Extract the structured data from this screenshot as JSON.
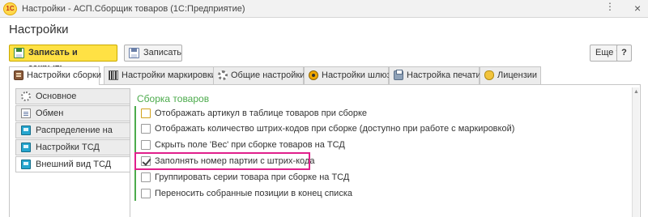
{
  "window": {
    "logo_text": "1С",
    "title": "Настройки - АСП.Сборщик товаров  (1С:Предприятие)",
    "more_glyph": "⋮",
    "close_glyph": "×"
  },
  "page": {
    "title": "Настройки"
  },
  "toolbar": {
    "save_close_label": "Записать и закрыть",
    "save_label": "Записать",
    "more_label": "Еще ▾",
    "help_label": "?"
  },
  "tabs": [
    {
      "label": "Настройки сборки",
      "icon": "settings-icon",
      "active": true
    },
    {
      "label": "Настройки маркировки",
      "icon": "barcode-icon",
      "active": false
    },
    {
      "label": "Общие настройки",
      "icon": "gear-icon",
      "active": false
    },
    {
      "label": "Настройки шлюз",
      "icon": "gateway-icon",
      "active": false
    },
    {
      "label": "Настройка печати",
      "icon": "printer-icon",
      "active": false
    },
    {
      "label": "Лицензии",
      "icon": "license-icon",
      "active": false
    }
  ],
  "sidebar": {
    "items": [
      {
        "label": "Основное",
        "icon": "cog-icon",
        "active": false
      },
      {
        "label": "Обмен",
        "icon": "document-icon",
        "active": false
      },
      {
        "label": "Распределение на ТСД",
        "icon": "tsd-icon",
        "active": false
      },
      {
        "label": "Настройки ТСД",
        "icon": "tsd-icon",
        "active": false
      },
      {
        "label": "Внешний вид ТСД",
        "icon": "tsd-icon",
        "active": true
      }
    ]
  },
  "group": {
    "title": "Сборка товаров",
    "options": [
      {
        "label": "Отображать артикул в таблице товаров при сборке",
        "checked": false
      },
      {
        "label": "Отображать количество штрих-кодов при сборке (доступно при работе с маркировкой)",
        "checked": false
      },
      {
        "label": "Скрыть поле 'Вес' при сборке товаров на ТСД",
        "checked": false
      },
      {
        "label": "Заполнять номер партии с штрих-кода",
        "checked": true
      },
      {
        "label": "Группировать серии товара при сборке на ТСД",
        "checked": false
      },
      {
        "label": "Переносить собранные позиции в конец списка",
        "checked": false
      }
    ]
  },
  "colors": {
    "primary_button": "#ffe144",
    "group_accent": "#4cab4c",
    "highlight": "#e0208c"
  }
}
